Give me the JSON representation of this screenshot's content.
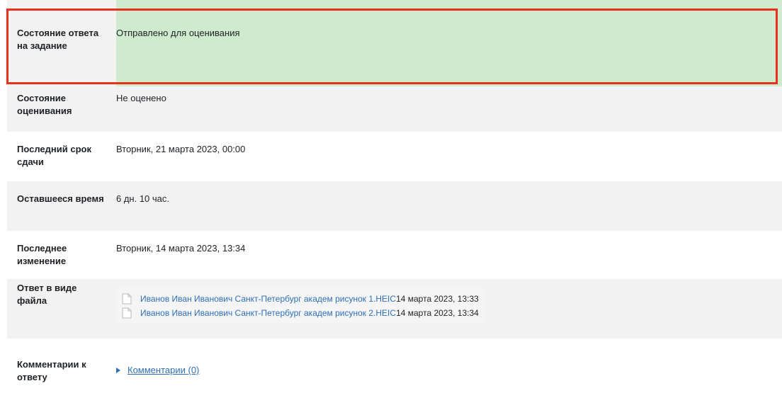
{
  "rows": [
    {
      "label": "Состояние ответа на задание",
      "value": "Отправлено для оценивания"
    },
    {
      "label": "Состояние оценивания",
      "value": "Не оценено"
    },
    {
      "label": "Последний срок сдачи",
      "value": "Вторник, 21 марта 2023, 00:00"
    },
    {
      "label": "Оставшееся время",
      "value": "6 дн. 10 час."
    },
    {
      "label": "Последнее изменение",
      "value": "Вторник, 14 марта 2023, 13:34"
    },
    {
      "label": "Ответ в виде файла",
      "files": [
        {
          "name": "Иванов Иван Иванович Санкт-Петербург академ рисунок 1.HEIC",
          "date": "14 марта 2023, 13:33"
        },
        {
          "name": "Иванов Иван Иванович Санкт-Петербург академ рисунок 2.HEIC",
          "date": "14 марта 2023, 13:34"
        }
      ]
    },
    {
      "label": "Комментарии к ответу",
      "comments_link": "Комментарии (0)"
    }
  ],
  "colors": {
    "highlight_bg": "#cfebcd",
    "frame": "#e8301c",
    "link": "#2f6fb7"
  }
}
